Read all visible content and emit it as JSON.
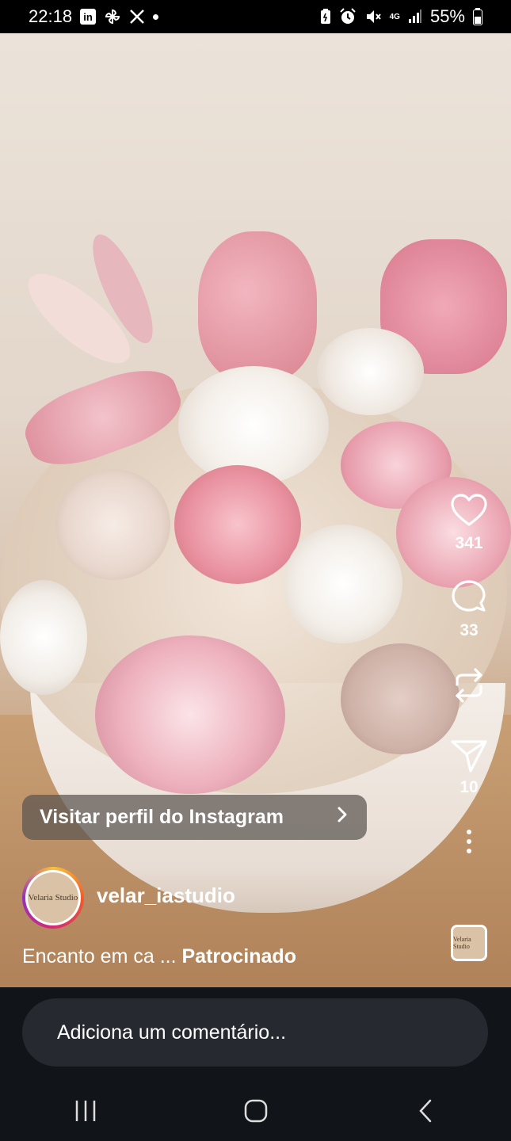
{
  "status_bar": {
    "time": "22:18",
    "linkedin_icon_text": "in",
    "battery": "55%",
    "network": "4G"
  },
  "reel": {
    "visit_profile_label": "Visitar perfil do Instagram",
    "username": "velar_iastudio",
    "avatar_text": "Velaria Studio",
    "caption_text": "Encanto em ca ...",
    "sponsored_label": "Patrocinado",
    "actions": {
      "likes": "341",
      "comments": "33",
      "shares": "10"
    }
  },
  "comment_input": {
    "placeholder": "Adiciona um comentário..."
  },
  "colors": {
    "comment_bg": "#262a30",
    "bottom_bg": "#111418"
  }
}
